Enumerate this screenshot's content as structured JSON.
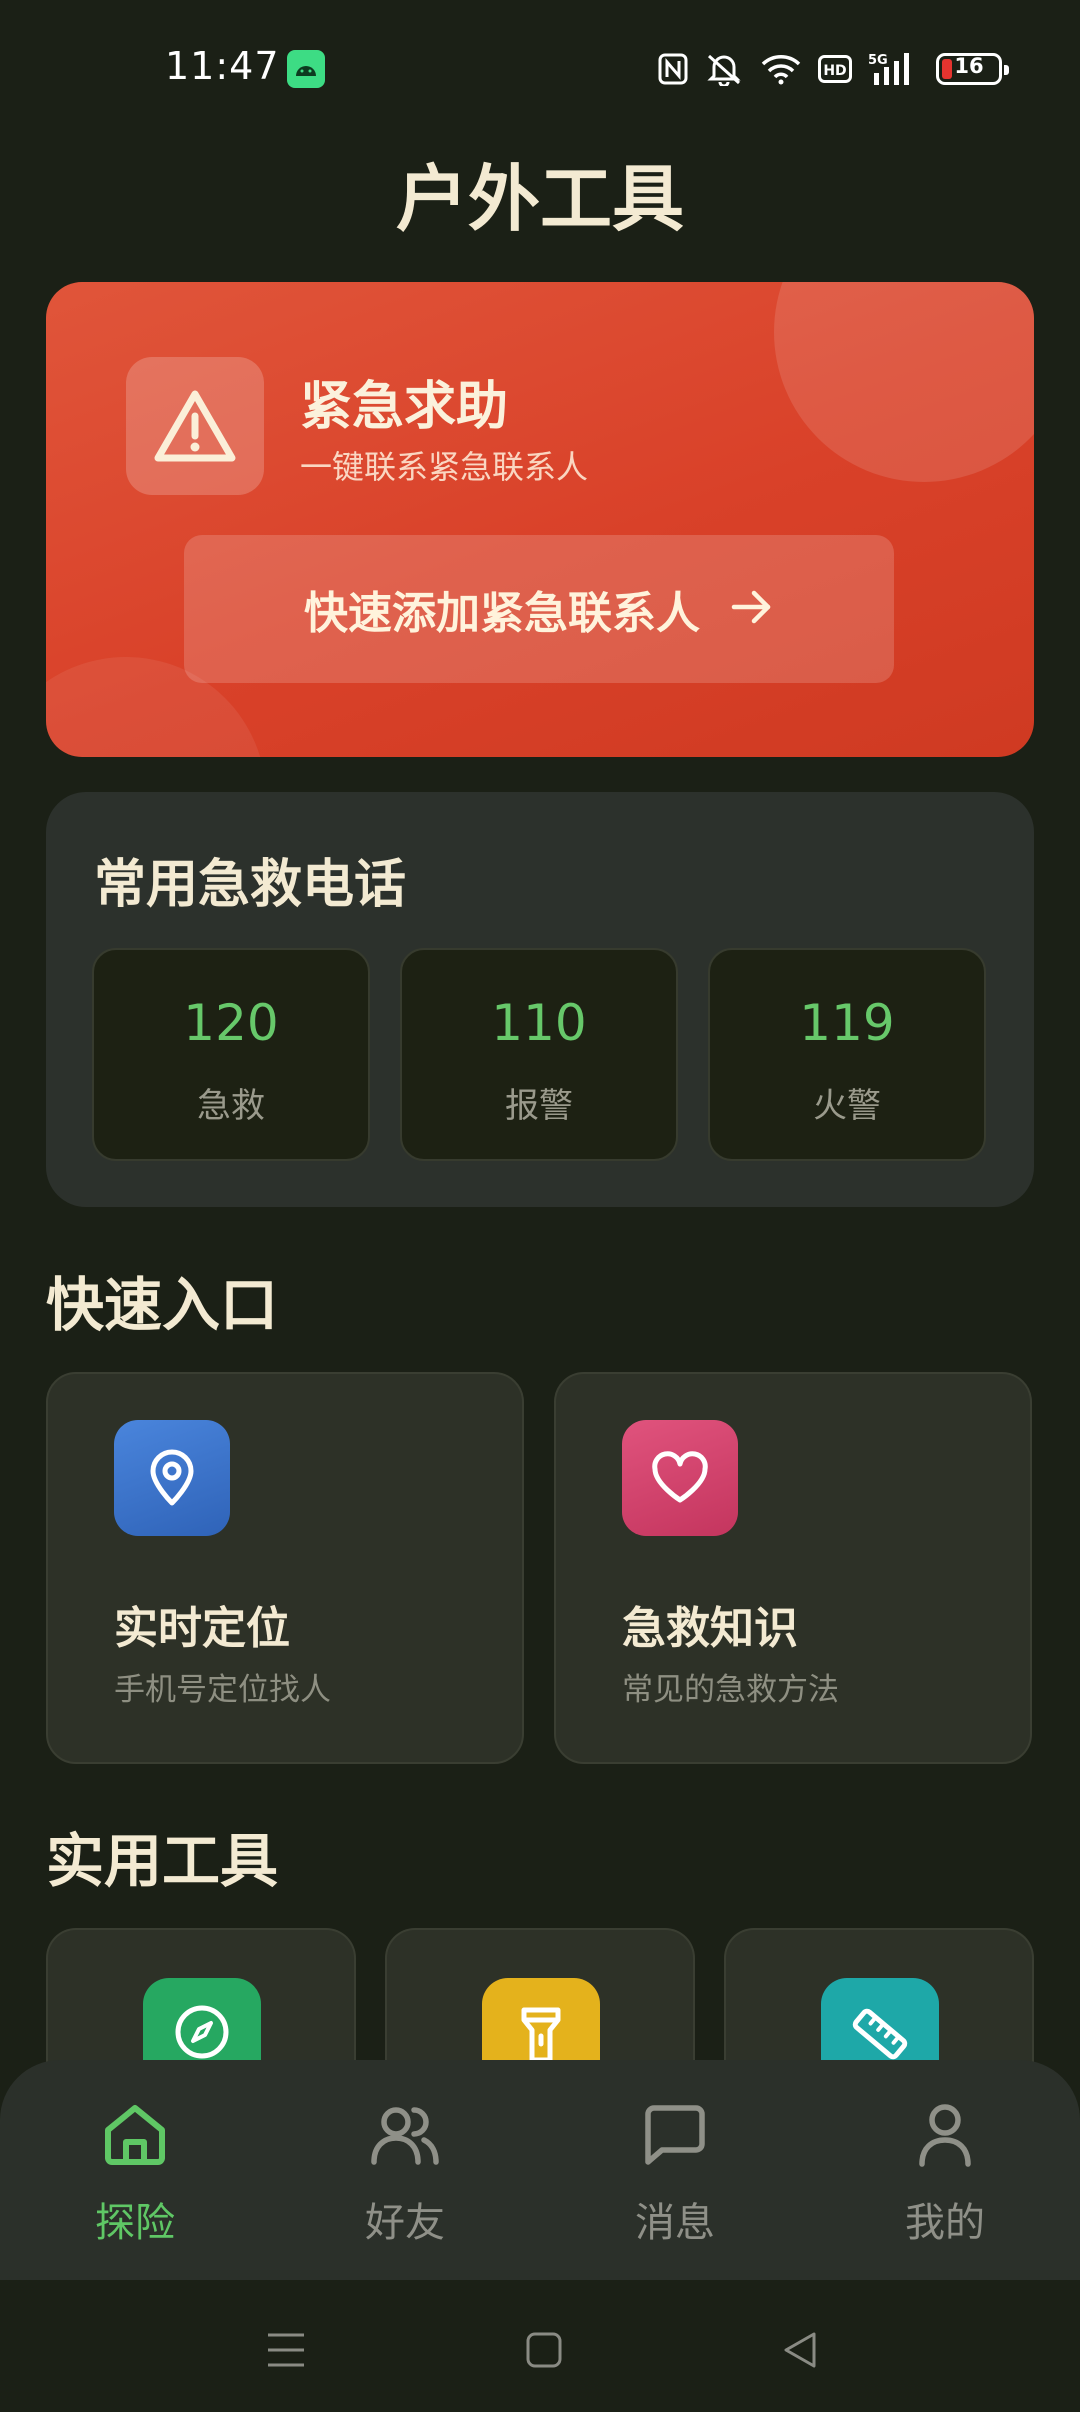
{
  "status_bar": {
    "time": "11:47",
    "icons": [
      "android-icon",
      "nfc-icon",
      "mute-icon",
      "wifi-icon",
      "hd-icon",
      "signal-5g-icon",
      "battery-icon"
    ],
    "network": "5G",
    "hd": "HD",
    "battery_level": "16"
  },
  "app_title": "户外工具",
  "emergency": {
    "title": "紧急求助",
    "subtitle": "一键联系紧急联系人",
    "button_label": "快速添加紧急联系人",
    "icon": "warning-triangle-icon",
    "accent": "#d94129"
  },
  "hotlines": {
    "title": "常用急救电话",
    "items": [
      {
        "number": "120",
        "label": "急救"
      },
      {
        "number": "110",
        "label": "报警"
      },
      {
        "number": "119",
        "label": "火警"
      }
    ],
    "number_color": "#67c86a"
  },
  "quick_entry": {
    "title": "快速入口",
    "items": [
      {
        "title": "实时定位",
        "subtitle": "手机号定位找人",
        "icon": "location-pin-icon",
        "color": "#3b72c9"
      },
      {
        "title": "急救知识",
        "subtitle": "常见的急救方法",
        "icon": "heart-icon",
        "color": "#d3446e"
      }
    ]
  },
  "tools": {
    "title": "实用工具",
    "items": [
      {
        "icon": "compass-icon",
        "color": "#26a861"
      },
      {
        "icon": "flashlight-icon",
        "color": "#e4b21c"
      },
      {
        "icon": "ruler-icon",
        "color": "#1ea8a8"
      }
    ]
  },
  "bottom_nav": {
    "items": [
      {
        "label": "探险",
        "icon": "home-icon",
        "active": true
      },
      {
        "label": "好友",
        "icon": "friends-icon",
        "active": false
      },
      {
        "label": "消息",
        "icon": "message-icon",
        "active": false
      },
      {
        "label": "我的",
        "icon": "profile-icon",
        "active": false
      }
    ],
    "active_color": "#5fc765"
  },
  "system_nav": [
    "menu-icon",
    "home-square-icon",
    "back-icon"
  ]
}
